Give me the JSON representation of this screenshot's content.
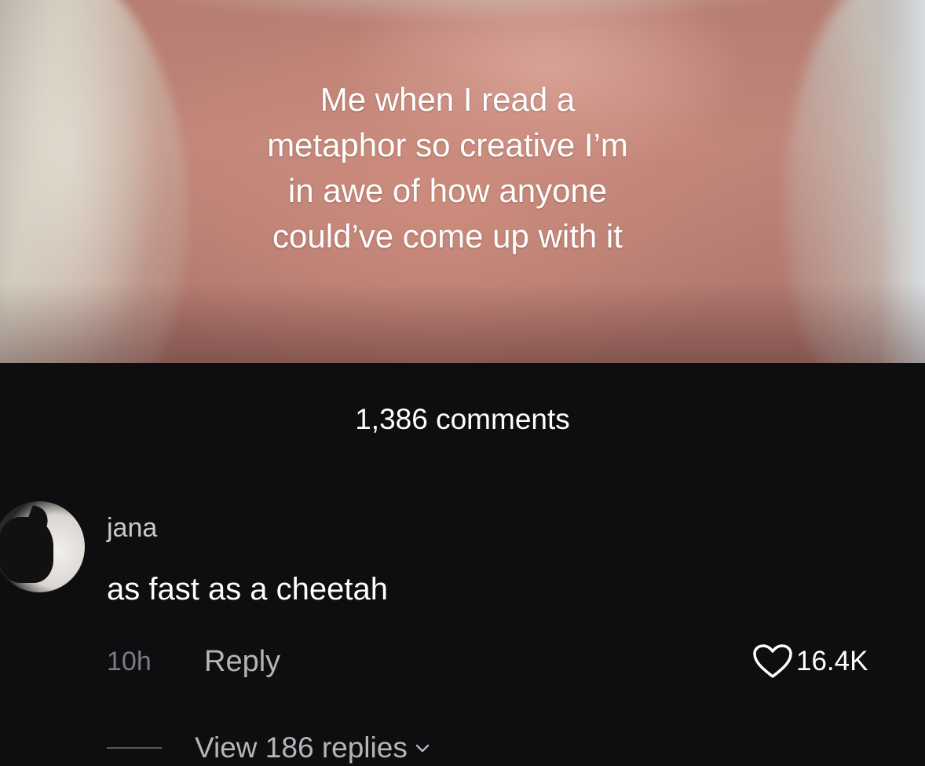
{
  "video": {
    "caption": "Me when I read a\nmetaphor so creative I’m\nin awe of how anyone\ncould’ve come up with it"
  },
  "comments": {
    "count_label": "1,386 comments",
    "items": [
      {
        "author": "jana",
        "text": "as fast as a cheetah",
        "time": "10h",
        "reply_label": "Reply",
        "likes": "16.4K",
        "view_replies_label": "View 186 replies",
        "avatar_icon": "cat-avatar"
      }
    ]
  },
  "icons": {
    "like": "heart-icon",
    "expand": "chevron-down-icon"
  },
  "colors": {
    "panel_background": "#0e0d10",
    "primary_text": "#ffffff",
    "secondary_text": "#7d7b7f"
  }
}
